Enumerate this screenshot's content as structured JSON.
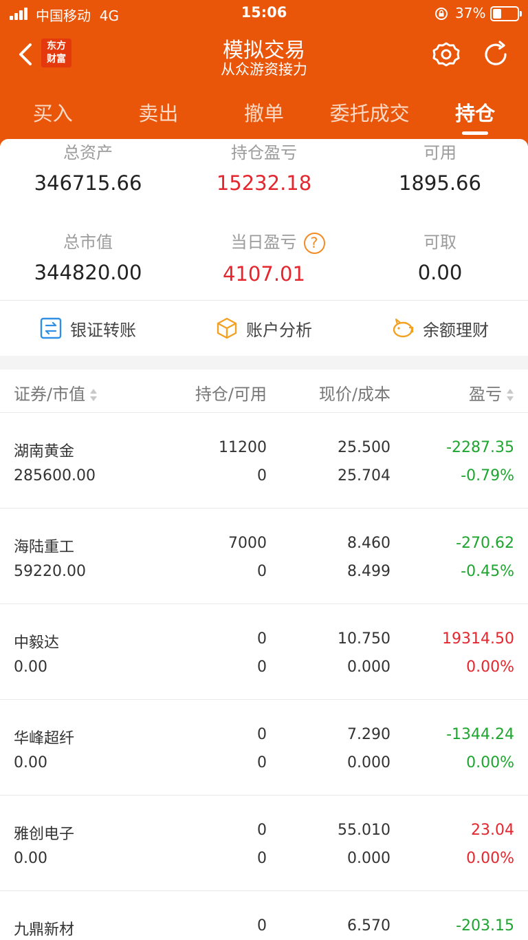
{
  "status_bar": {
    "carrier": "中国移动",
    "network": "4G",
    "time": "15:06",
    "battery": "37%"
  },
  "nav": {
    "logo_line1": "东方",
    "logo_line2": "财富",
    "title": "模拟交易",
    "subtitle": "从众游资接力"
  },
  "tabs": [
    {
      "label": "买入"
    },
    {
      "label": "卖出"
    },
    {
      "label": "撤单"
    },
    {
      "label": "委托成交"
    },
    {
      "label": "持仓",
      "active": true
    }
  ],
  "summary": {
    "total_assets": {
      "label": "总资产",
      "value": "346715.66"
    },
    "position_pl": {
      "label": "持仓盈亏",
      "value": "15232.18"
    },
    "available": {
      "label": "可用",
      "value": "1895.66"
    },
    "market_value": {
      "label": "总市值",
      "value": "344820.00"
    },
    "daily_pl": {
      "label": "当日盈亏",
      "value": "4107.01",
      "help": "?"
    },
    "withdrawable": {
      "label": "可取",
      "value": "0.00"
    }
  },
  "actions": [
    {
      "label": "银证转账",
      "icon": "transfer-icon"
    },
    {
      "label": "账户分析",
      "icon": "box-icon"
    },
    {
      "label": "余额理财",
      "icon": "piggy-bank-icon"
    }
  ],
  "table": {
    "headers": [
      "证券/市值",
      "持仓/可用",
      "现价/成本",
      "盈亏"
    ],
    "rows": [
      {
        "name": "湖南黄金",
        "market_value": "285600.00",
        "position": "11200",
        "available": "0",
        "price": "25.500",
        "cost": "25.704",
        "pl": "-2287.35",
        "pl_pct": "-0.79%",
        "pl_color": "green",
        "pct_color": "green"
      },
      {
        "name": "海陆重工",
        "market_value": "59220.00",
        "position": "7000",
        "available": "0",
        "price": "8.460",
        "cost": "8.499",
        "pl": "-270.62",
        "pl_pct": "-0.45%",
        "pl_color": "green",
        "pct_color": "green"
      },
      {
        "name": "中毅达",
        "market_value": "0.00",
        "position": "0",
        "available": "0",
        "price": "10.750",
        "cost": "0.000",
        "pl": "19314.50",
        "pl_pct": "0.00%",
        "pl_color": "red",
        "pct_color": "red"
      },
      {
        "name": "华峰超纤",
        "market_value": "0.00",
        "position": "0",
        "available": "0",
        "price": "7.290",
        "cost": "0.000",
        "pl": "-1344.24",
        "pl_pct": "0.00%",
        "pl_color": "green",
        "pct_color": "green"
      },
      {
        "name": "雅创电子",
        "market_value": "0.00",
        "position": "0",
        "available": "0",
        "price": "55.010",
        "cost": "0.000",
        "pl": "23.04",
        "pl_pct": "0.00%",
        "pl_color": "red",
        "pct_color": "red"
      },
      {
        "name": "九鼎新材",
        "market_value": "",
        "position": "0",
        "available": "",
        "price": "6.570",
        "cost": "",
        "pl": "-203.15",
        "pl_pct": "",
        "pl_color": "green",
        "pct_color": "green"
      }
    ]
  },
  "colors": {
    "header_bg": "#e9560a",
    "profit_red": "#e4262e",
    "loss_green": "#1ea52f",
    "accent_orange": "#f38a22",
    "link_blue": "#2e8fe5"
  }
}
